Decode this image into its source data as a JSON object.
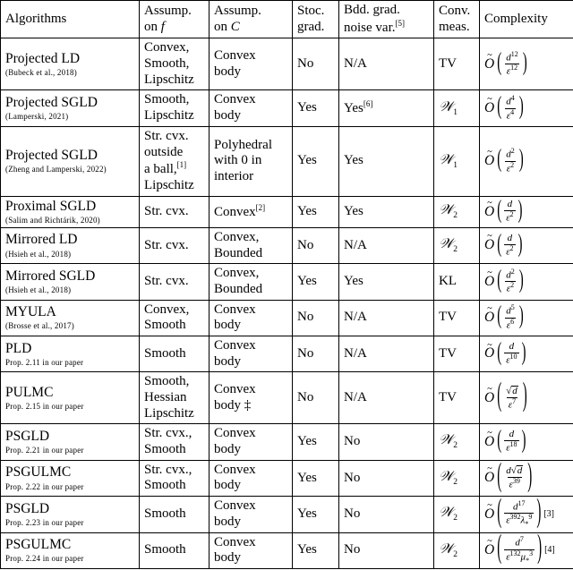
{
  "table": {
    "headers": [
      "Algorithms",
      "Assump. on f",
      "Assump. on C",
      "Stoc. grad.",
      "Bdd. grad. noise var.",
      "Conv. meas.",
      "Complexity"
    ],
    "header_parts": {
      "algorithms": "Algorithms",
      "assump_f_l1": "Assump.",
      "assump_f_l2": "on",
      "assump_f_sym": "f",
      "assump_C_l1": "Assump.",
      "assump_C_l2": "on",
      "assump_C_sym": "C",
      "stoc_l1": "Stoc.",
      "stoc_l2": "grad.",
      "bdd_l1": "Bdd. grad.",
      "bdd_l2": "noise var.",
      "bdd_fn": "[5]",
      "conv_l1": "Conv.",
      "conv_l2": "meas.",
      "complexity": "Complexity"
    },
    "rows": [
      {
        "name": "Projected LD",
        "ref": "(Bubeck et al., 2018)",
        "assump_f": "Convex,\nSmooth,\nLipschitz",
        "assump_C": "Convex\nbody",
        "stoc_grad": "No",
        "bdd_noise": "N/A",
        "bdd_noise_fn": "",
        "conv_meas": "TV",
        "conv_meas_sub": "",
        "cx_num_base": "d",
        "cx_num_exp": "12",
        "cx_den_base": "ε",
        "cx_den_exp": "12",
        "cx_den_extra": "",
        "cx_den_extra_exp": "",
        "cx_sqrt": false,
        "cx_fn": "",
        "thick_top": false
      },
      {
        "name": "Projected SGLD",
        "ref": "(Lamperski, 2021)",
        "assump_f": "Smooth,\nLipschitz",
        "assump_C": "Convex\nbody",
        "stoc_grad": "Yes",
        "bdd_noise": "Yes",
        "bdd_noise_fn": "[6]",
        "conv_meas": "W",
        "conv_meas_sub": "1",
        "cx_num_base": "d",
        "cx_num_exp": "4",
        "cx_den_base": "ε",
        "cx_den_exp": "4",
        "cx_den_extra": "",
        "cx_den_extra_exp": "",
        "cx_sqrt": false,
        "cx_fn": "",
        "thick_top": false
      },
      {
        "name": "Projected SGLD",
        "ref": "(Zheng and Lamperski, 2022)",
        "assump_f": "Str. cvx.\noutside\na ball,[1]\nLipschitz",
        "assump_C": "Polyhedral\nwith 0 in\ninterior",
        "stoc_grad": "Yes",
        "bdd_noise": "Yes",
        "bdd_noise_fn": "",
        "conv_meas": "W",
        "conv_meas_sub": "1",
        "cx_num_base": "d",
        "cx_num_exp": "2",
        "cx_den_base": "ε",
        "cx_den_exp": "2",
        "cx_den_extra": "",
        "cx_den_extra_exp": "",
        "cx_sqrt": false,
        "cx_fn": "",
        "thick_top": false
      },
      {
        "name": "Proximal SGLD",
        "ref": "(Salim and Richtárik, 2020)",
        "assump_f": "Str. cvx.",
        "assump_C": "Convex[2]",
        "stoc_grad": "Yes",
        "bdd_noise": "Yes",
        "bdd_noise_fn": "",
        "conv_meas": "W",
        "conv_meas_sub": "2",
        "cx_num_base": "d",
        "cx_num_exp": "",
        "cx_den_base": "ε",
        "cx_den_exp": "2",
        "cx_den_extra": "",
        "cx_den_extra_exp": "",
        "cx_sqrt": false,
        "cx_fn": "",
        "thick_top": false
      },
      {
        "name": "Mirrored LD",
        "ref": "(Hsieh et al., 2018)",
        "assump_f": "Str. cvx.",
        "assump_C": "Convex,\nBounded",
        "stoc_grad": "No",
        "bdd_noise": "N/A",
        "bdd_noise_fn": "",
        "conv_meas": "W",
        "conv_meas_sub": "2",
        "cx_num_base": "d",
        "cx_num_exp": "",
        "cx_den_base": "ε",
        "cx_den_exp": "2",
        "cx_den_extra": "",
        "cx_den_extra_exp": "",
        "cx_sqrt": false,
        "cx_fn": "",
        "thick_top": false
      },
      {
        "name": "Mirrored SGLD",
        "ref": "(Hsieh et al., 2018)",
        "assump_f": "Str. cvx.",
        "assump_C": "Convex,\nBounded",
        "stoc_grad": "Yes",
        "bdd_noise": "Yes",
        "bdd_noise_fn": "",
        "conv_meas": "KL",
        "conv_meas_sub": "",
        "cx_num_base": "d",
        "cx_num_exp": "2",
        "cx_den_base": "ε",
        "cx_den_exp": "2",
        "cx_den_extra": "",
        "cx_den_extra_exp": "",
        "cx_sqrt": false,
        "cx_fn": "",
        "thick_top": false
      },
      {
        "name": "MYULA",
        "ref": "(Brosse et al., 2017)",
        "assump_f": "Convex,\nSmooth",
        "assump_C": "Convex\nbody",
        "stoc_grad": "No",
        "bdd_noise": "N/A",
        "bdd_noise_fn": "",
        "conv_meas": "TV",
        "conv_meas_sub": "",
        "cx_num_base": "d",
        "cx_num_exp": "5",
        "cx_den_base": "ε",
        "cx_den_exp": "6",
        "cx_den_extra": "",
        "cx_den_extra_exp": "",
        "cx_sqrt": false,
        "cx_fn": "",
        "thick_top": false
      },
      {
        "name": "PLD",
        "ref": "Prop. 2.11 in our paper",
        "assump_f": "Smooth",
        "assump_C": "Convex\nbody",
        "stoc_grad": "No",
        "bdd_noise": "N/A",
        "bdd_noise_fn": "",
        "conv_meas": "TV",
        "conv_meas_sub": "",
        "cx_num_base": "d",
        "cx_num_exp": "",
        "cx_den_base": "ε",
        "cx_den_exp": "10",
        "cx_den_extra": "",
        "cx_den_extra_exp": "",
        "cx_sqrt": false,
        "cx_fn": "",
        "thick_top": false
      },
      {
        "name": "PULMC",
        "ref": "Prop. 2.15 in our paper",
        "assump_f": "Smooth,\nHessian\nLipschitz",
        "assump_C": "Convex\nbody ‡",
        "stoc_grad": "No",
        "bdd_noise": "N/A",
        "bdd_noise_fn": "",
        "conv_meas": "TV",
        "conv_meas_sub": "",
        "cx_num_base": "d",
        "cx_num_exp": "",
        "cx_den_base": "ε",
        "cx_den_exp": "7",
        "cx_den_extra": "",
        "cx_den_extra_exp": "",
        "cx_sqrt": true,
        "cx_fn": "",
        "thick_top": false
      },
      {
        "name": "PSGLD",
        "ref": "Prop. 2.21 in our paper",
        "assump_f": "Str. cvx.,\nSmooth",
        "assump_C": "Convex\nbody",
        "stoc_grad": "Yes",
        "bdd_noise": "No",
        "bdd_noise_fn": "",
        "conv_meas": "W",
        "conv_meas_sub": "2",
        "cx_num_base": "d",
        "cx_num_exp": "",
        "cx_den_base": "ε",
        "cx_den_exp": "18",
        "cx_den_extra": "",
        "cx_den_extra_exp": "",
        "cx_sqrt": false,
        "cx_fn": "",
        "thick_top": false
      },
      {
        "name": "PSGULMC",
        "ref": "Prop. 2.22 in our paper",
        "assump_f": "Str. cvx.,\nSmooth",
        "assump_C": "Convex\nbody",
        "stoc_grad": "Yes",
        "bdd_noise": "No",
        "bdd_noise_fn": "",
        "conv_meas": "W",
        "conv_meas_sub": "2",
        "cx_num_base": "d",
        "cx_num_exp": "",
        "cx_den_base": "ε",
        "cx_den_exp": "39",
        "cx_den_extra": "",
        "cx_den_extra_exp": "",
        "cx_sqrt": true,
        "cx_sqrt_prefix": "d",
        "cx_fn": "",
        "thick_top": false
      },
      {
        "name": "PSGLD",
        "ref": "Prop. 2.23 in our paper",
        "assump_f": "Smooth",
        "assump_C": "Convex\nbody",
        "stoc_grad": "Yes",
        "bdd_noise": "No",
        "bdd_noise_fn": "",
        "conv_meas": "W",
        "conv_meas_sub": "2",
        "cx_num_base": "d",
        "cx_num_exp": "17",
        "cx_den_base": "ε",
        "cx_den_exp": "392",
        "cx_den_extra": "λ",
        "cx_den_extra_exp": "9",
        "cx_den_extra_sub": "*",
        "cx_sqrt": false,
        "cx_fn": "[3]",
        "thick_top": true
      },
      {
        "name": "PSGULMC",
        "ref": "Prop. 2.24 in our paper",
        "assump_f": "Smooth",
        "assump_C": "Convex\nbody",
        "stoc_grad": "Yes",
        "bdd_noise": "No",
        "bdd_noise_fn": "",
        "conv_meas": "W",
        "conv_meas_sub": "2",
        "cx_num_base": "d",
        "cx_num_exp": "7",
        "cx_den_base": "ε",
        "cx_den_exp": "132",
        "cx_den_extra": "μ",
        "cx_den_extra_exp": "3",
        "cx_den_extra_sub": "*",
        "cx_sqrt": false,
        "cx_fn": "[4]",
        "thick_top": false
      }
    ]
  }
}
